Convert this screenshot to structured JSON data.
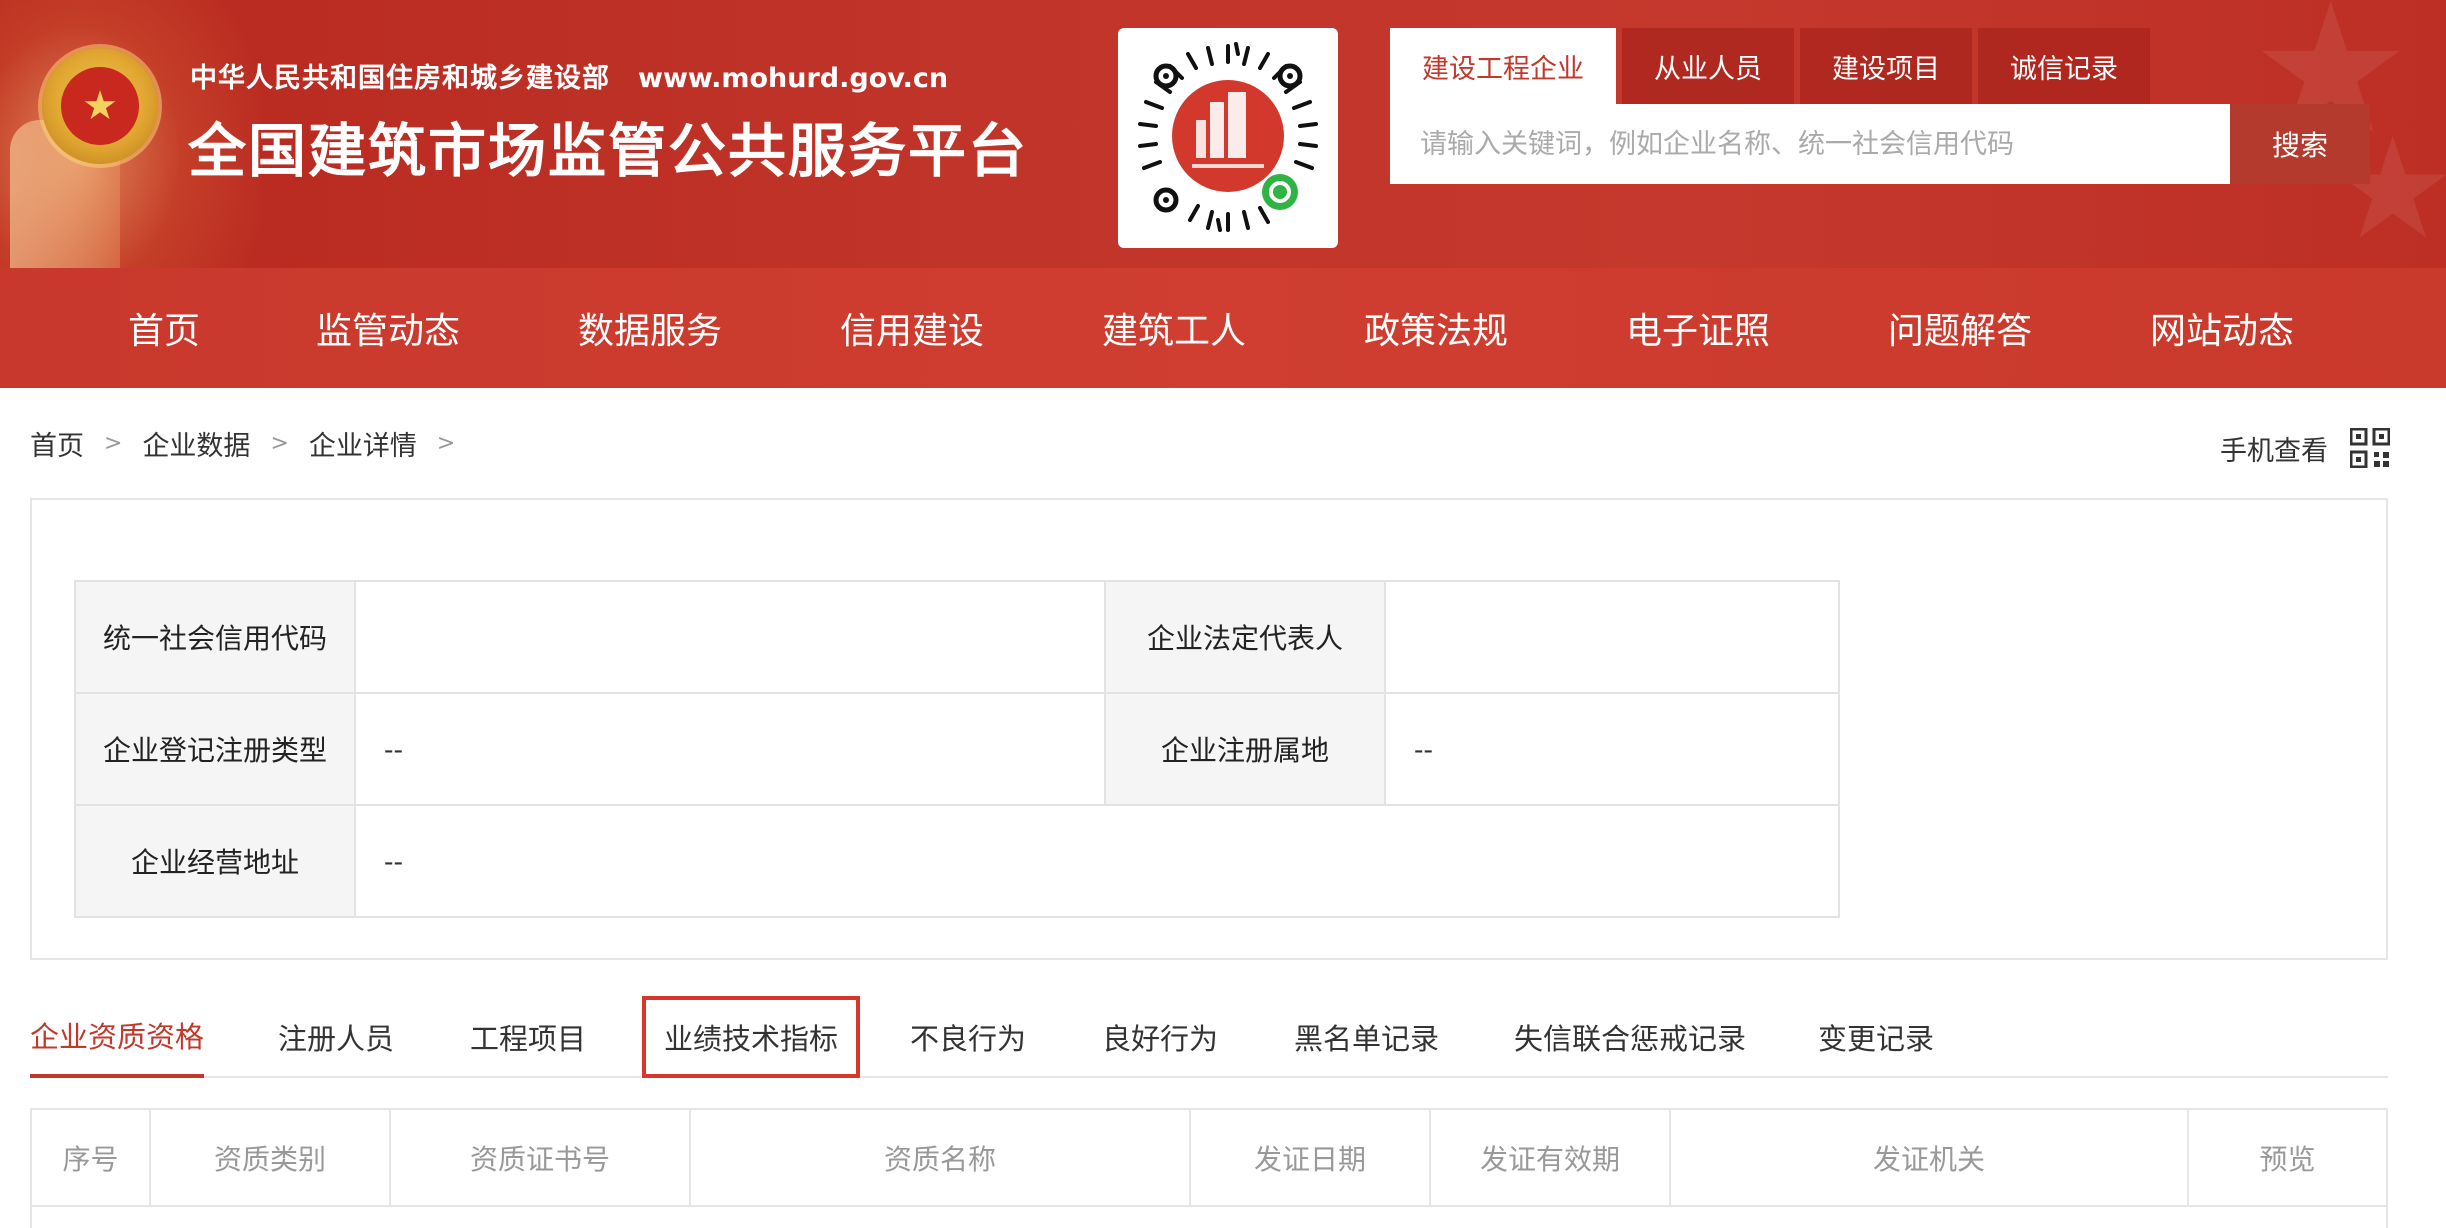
{
  "header": {
    "ministry": "中华人民共和国住房和城乡建设部",
    "url": "www.mohurd.gov.cn",
    "platform_title": "全国建筑市场监管公共服务平台"
  },
  "search": {
    "tabs": [
      "建设工程企业",
      "从业人员",
      "建设项目",
      "诚信记录"
    ],
    "active_tab": 0,
    "placeholder": "请输入关键词，例如企业名称、统一社会信用代码",
    "button_label": "搜索"
  },
  "nav": {
    "items": [
      "首页",
      "监管动态",
      "数据服务",
      "信用建设",
      "建筑工人",
      "政策法规",
      "电子证照",
      "问题解答",
      "网站动态"
    ]
  },
  "breadcrumb": {
    "items": [
      "首页",
      "企业数据",
      "企业详情"
    ]
  },
  "mobile_view": {
    "label": "手机查看"
  },
  "company_info": {
    "credit_code_label": "统一社会信用代码",
    "credit_code_value": "",
    "legal_rep_label": "企业法定代表人",
    "legal_rep_value": "",
    "reg_type_label": "企业登记注册类型",
    "reg_type_value": "--",
    "reg_location_label": "企业注册属地",
    "reg_location_value": "--",
    "address_label": "企业经营地址",
    "address_value": "--"
  },
  "tabs": {
    "items": [
      "企业资质资格",
      "注册人员",
      "工程项目",
      "业绩技术指标",
      "不良行为",
      "良好行为",
      "黑名单记录",
      "失信联合惩戒记录",
      "变更记录"
    ],
    "active": 0,
    "highlighted": 3
  },
  "qualification_table": {
    "headers": [
      "序号",
      "资质类别",
      "资质证书号",
      "资质名称",
      "发证日期",
      "发证有效期",
      "发证机关",
      "预览"
    ]
  },
  "colors": {
    "brand_red": "#c0392b",
    "header_red": "#c0342a",
    "search_button": "#b33a2c"
  }
}
